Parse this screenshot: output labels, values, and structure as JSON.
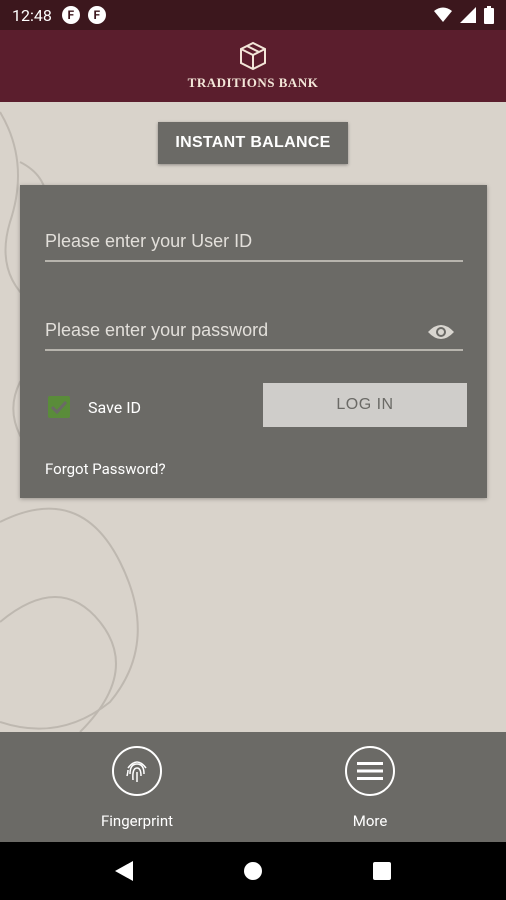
{
  "status_bar": {
    "time": "12:48",
    "app_icon_1": "F",
    "app_icon_2": "F"
  },
  "header": {
    "brand": "TRADITIONS BANK",
    "logo_icon": "cube-logo-icon"
  },
  "instant_balance": {
    "label": "INSTANT BALANCE"
  },
  "login": {
    "user_placeholder": "Please enter your User ID",
    "user_value": "",
    "password_placeholder": "Please enter your password",
    "password_value": "",
    "save_id_label": "Save ID",
    "save_id_checked": true,
    "login_button": "LOG IN",
    "forgot_password": "Forgot Password?"
  },
  "bottom_nav": {
    "fingerprint_label": "Fingerprint",
    "more_label": "More"
  },
  "colors": {
    "header": "#5b1e2d",
    "status": "#3c171d",
    "card": "#6b6a66",
    "background": "#d9d3cb",
    "checkbox": "#5a8c3a"
  }
}
